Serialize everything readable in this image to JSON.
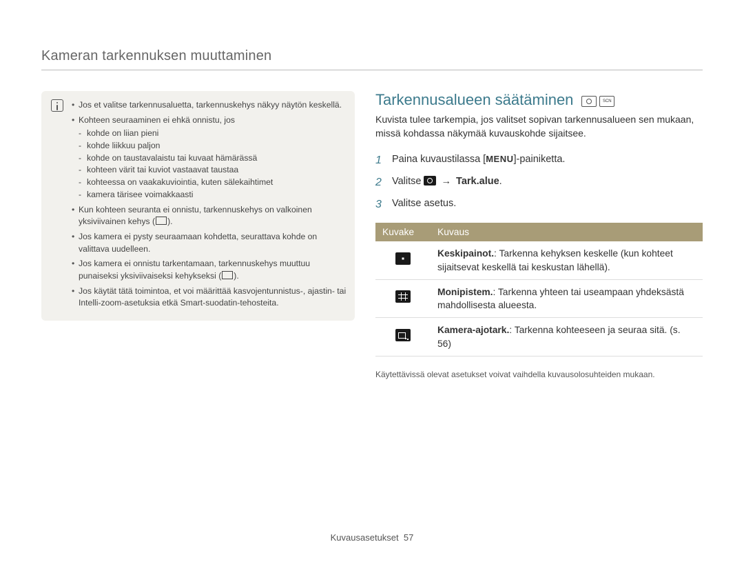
{
  "header": {
    "title": "Kameran tarkennuksen muuttaminen"
  },
  "note": {
    "items": [
      {
        "text": "Jos et valitse tarkennusaluetta, tarkennuskehys näkyy näytön keskellä."
      },
      {
        "text": "Kohteen seuraaminen ei ehkä onnistu, jos",
        "sub": [
          "kohde on liian pieni",
          "kohde liikkuu paljon",
          "kohde on taustavalaistu tai kuvaat hämärässä",
          "kohteen värit tai kuviot vastaavat taustaa",
          "kohteessa on vaakakuviointia, kuten sälekaihtimet",
          "kamera tärisee voimakkaasti"
        ]
      },
      {
        "text_a": "Kun kohteen seuranta ei onnistu, tarkennuskehys on valkoinen yksiviivainen kehys (",
        "text_b": ")."
      },
      {
        "text": "Jos kamera ei pysty seuraamaan kohdetta, seurattava kohde on valittava uudelleen."
      },
      {
        "text_a": "Jos kamera ei onnistu tarkentamaan, tarkennuskehys muuttuu punaiseksi yksiviivaiseksi kehykseksi (",
        "text_b": ")."
      },
      {
        "text": "Jos käytät tätä toimintoa, et voi määrittää kasvojentunnistus-, ajastin- tai Intelli-zoom-asetuksia etkä Smart-suodatin-tehosteita."
      }
    ]
  },
  "section": {
    "title": "Tarkennusalueen säätäminen",
    "intro": "Kuvista tulee tarkempia, jos valitset sopivan tarkennusalueen sen mukaan, missä kohdassa näkymää kuvauskohde sijaitsee.",
    "steps": {
      "s1_a": "Paina kuvaustilassa [",
      "s1_menu": "MENU",
      "s1_b": "]-painiketta.",
      "s2_a": "Valitse ",
      "s2_arrow": "→",
      "s2_target": "Tark.alue",
      "s2_end": ".",
      "s3": "Valitse asetus."
    },
    "table": {
      "h1": "Kuvake",
      "h2": "Kuvaus",
      "rows": [
        {
          "name": "Keskipainot.",
          "desc": ": Tarkenna kehyksen keskelle (kun kohteet sijaitsevat keskellä tai keskustan lähellä)."
        },
        {
          "name": "Monipistem.",
          "desc": ": Tarkenna yhteen tai useampaan yhdeksästä mahdollisesta alueesta."
        },
        {
          "name": "Kamera-ajotark.",
          "desc": ": Tarkenna kohteeseen ja seuraa sitä. (s. 56)"
        }
      ]
    },
    "footnote": "Käytettävissä olevat asetukset voivat vaihdella kuvausolosuhteiden mukaan."
  },
  "footer": {
    "section": "Kuvausasetukset",
    "page": "57"
  }
}
